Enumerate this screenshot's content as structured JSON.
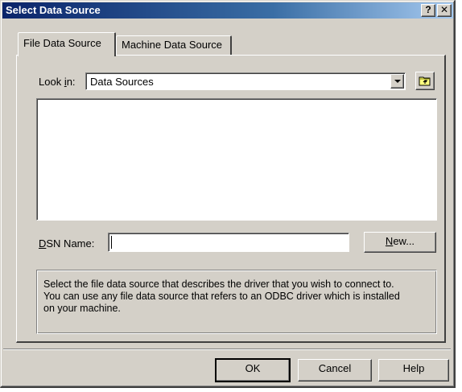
{
  "window": {
    "title": "Select Data Source",
    "help_button": "?",
    "close_button": "✕"
  },
  "tabs": [
    {
      "label": "File Data Source",
      "active": true
    },
    {
      "label": "Machine Data Source",
      "active": false
    }
  ],
  "look_in": {
    "label_prefix": "Look ",
    "label_accel": "i",
    "label_suffix": "n:",
    "value": "Data Sources"
  },
  "dsn": {
    "label_accel": "D",
    "label_suffix": "SN Name:",
    "value": "",
    "new_button_accel": "N",
    "new_button_suffix": "ew..."
  },
  "info": {
    "lines": [
      "Select the file data source that describes the driver that you wish to connect to.",
      "You can use any file data source that refers to an ODBC driver which is installed",
      "on your machine."
    ]
  },
  "buttons": {
    "ok": "OK",
    "cancel": "Cancel",
    "help": "Help"
  },
  "icons": {
    "up_folder": "up-folder-icon",
    "dropdown": "chevron-down-icon"
  },
  "colors": {
    "dialog_face": "#d4d0c8",
    "titlebar_start": "#0a246a",
    "titlebar_end": "#a6caf0"
  }
}
